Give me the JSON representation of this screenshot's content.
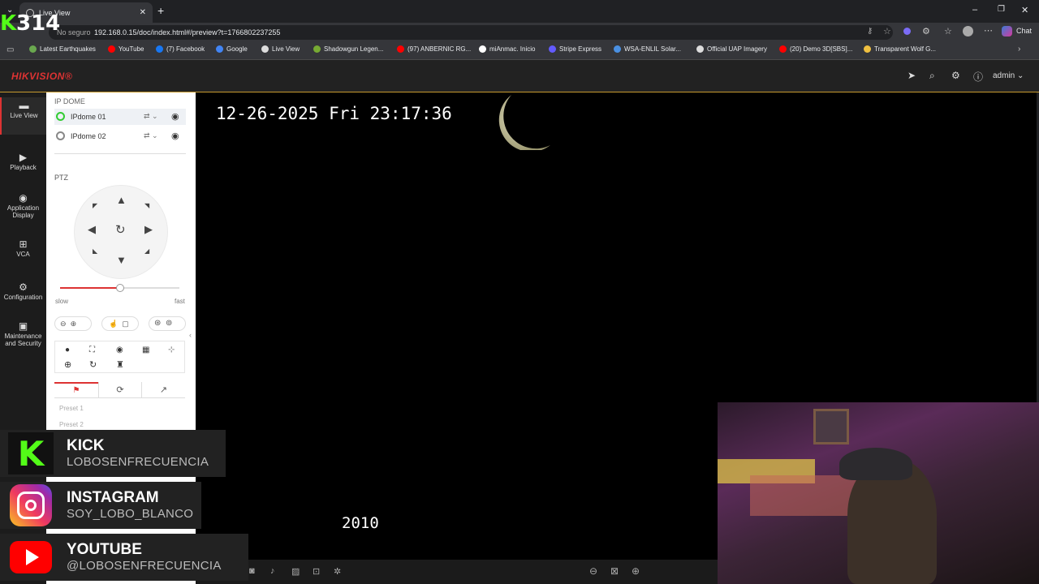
{
  "browser": {
    "tab_title": "Live View",
    "security_label": "No seguro",
    "url": "192.168.0.15/doc/index.html#/preview?t=1766802237255",
    "chat_label": "Chat",
    "bookmarks": [
      {
        "label": "Latest Earthquakes",
        "color": "#6aa84f"
      },
      {
        "label": "YouTube",
        "color": "#ff0000"
      },
      {
        "label": "(7) Facebook",
        "color": "#1877f2"
      },
      {
        "label": "Google",
        "color": "#4285f4"
      },
      {
        "label": "Live View",
        "color": "#dddddd"
      },
      {
        "label": "Shadowgun Legen...",
        "color": "#77aa33"
      },
      {
        "label": "(97) ANBERNIC RG...",
        "color": "#ff0000"
      },
      {
        "label": "miAnmac. Inicio",
        "color": "#ffffff"
      },
      {
        "label": "Stripe Express",
        "color": "#635bff"
      },
      {
        "label": "WSA-ENLIL Solar...",
        "color": "#4a90e2"
      },
      {
        "label": "Official UAP Imagery",
        "color": "#dddddd"
      },
      {
        "label": "(20) Demo 3D[SBS]...",
        "color": "#ff0000"
      },
      {
        "label": "Transparent Wolf G...",
        "color": "#f0c040"
      }
    ]
  },
  "header": {
    "logo": "HIKVISION®",
    "user": "admin"
  },
  "nav": {
    "live": "Live View",
    "playback": "Playback",
    "application": "Application Display",
    "vca": "VCA",
    "configuration": "Configuration",
    "maintenance": "Maintenance and Security"
  },
  "panel": {
    "group": "IP DOME",
    "cameras": [
      "IPdome 01",
      "IPdome 02"
    ],
    "ptz_label": "PTZ",
    "slow": "slow",
    "fast": "fast",
    "speed_fraction": 0.5,
    "presets": [
      "Preset 1",
      "Preset 2"
    ]
  },
  "video": {
    "osd_time": "12-26-2025 Fri 23:17:36",
    "osd_year": "2010"
  },
  "stream": {
    "counter": "314",
    "socials": [
      {
        "name": "KICK",
        "handle": "LOBOSENFRECUENCIA"
      },
      {
        "name": "INSTAGRAM",
        "handle": "SOY_LOBO_BLANCO"
      },
      {
        "name": "YOUTUBE",
        "handle": "@LOBOSENFRECUENCIA"
      }
    ]
  },
  "colors": {
    "accent": "#dd3333",
    "kick": "#53fc18",
    "hik_red": "#d33333"
  }
}
